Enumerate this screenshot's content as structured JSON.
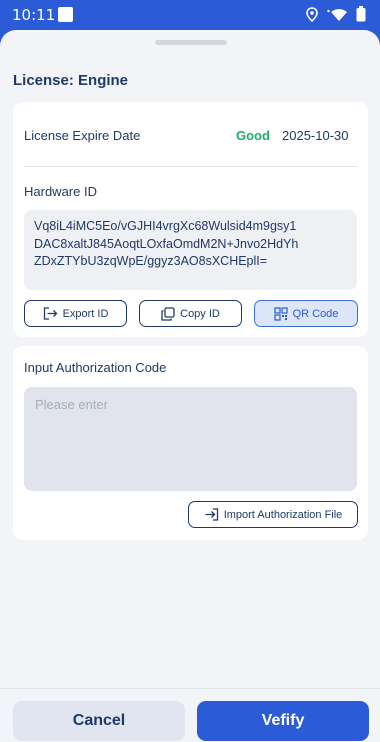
{
  "status_bar": {
    "time": "10:11",
    "icons": [
      "location-icon",
      "wifi-icon",
      "battery-icon"
    ]
  },
  "page": {
    "title": "License:  Engine"
  },
  "license": {
    "expire_label": "License Expire Date",
    "status": "Good",
    "expire_date": "2025-10-30"
  },
  "hardware": {
    "label": "Hardware ID",
    "id_lines": [
      "Vq8iL4iMC5Eo/vGJHI4vrgXc68Wulsid4m9gsy1",
      "DAC8xaltJ845AoqtLOxfaOmdM2N+Jnvo2HdYh",
      "ZDxZTYbU3zqWpE/ggyz3AO8sXCHEplI="
    ],
    "buttons": {
      "export": "Export ID",
      "copy": "Copy ID",
      "qr": "QR Code"
    }
  },
  "authorization": {
    "label": "Input Authorization Code",
    "placeholder": "Please enter",
    "value": "",
    "import_label": "Import Authorization File"
  },
  "footer": {
    "cancel": "Cancel",
    "verify": "Vefify"
  },
  "colors": {
    "accent": "#2b5bd6",
    "status_good": "#1fae6b",
    "text_primary": "#1f3a66",
    "background": "#f2f4f8"
  }
}
